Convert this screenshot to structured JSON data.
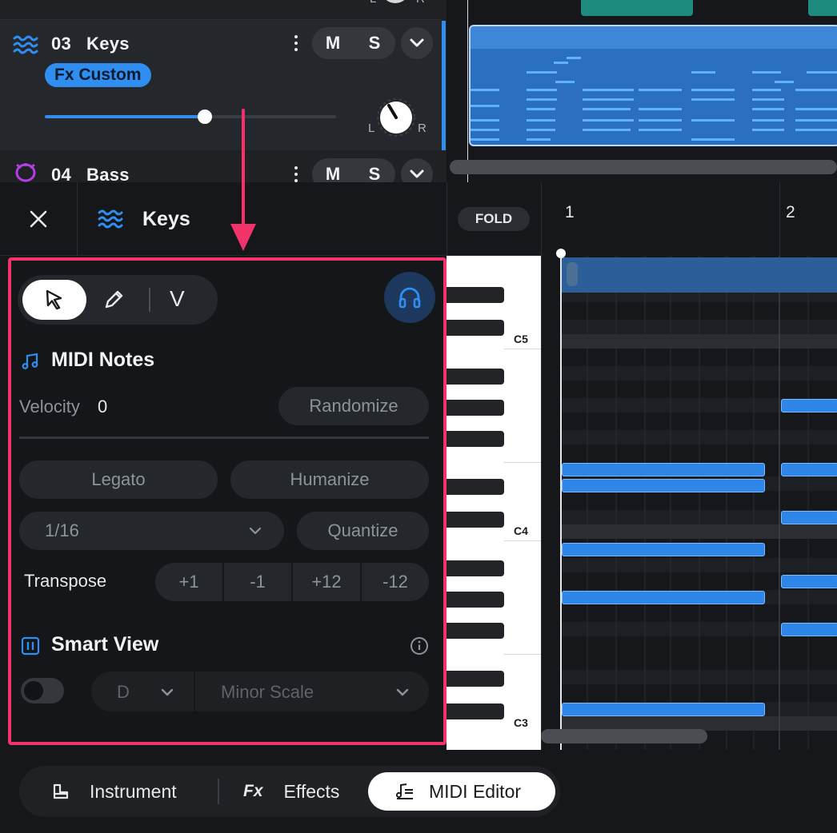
{
  "tracks": [
    {
      "number": "03",
      "name": "Keys",
      "fx_badge": "Fx Custom",
      "mute": "M",
      "solo": "S",
      "volume": 0.55,
      "pan_left": "L",
      "pan_right": "R",
      "color": "#2f8ef0"
    },
    {
      "number": "04",
      "name": "Bass",
      "mute": "M",
      "solo": "S",
      "color": "#b13ee6"
    }
  ],
  "top_pan_right": "R",
  "top_pan_left": "L",
  "editor": {
    "track_name": "Keys",
    "fold_label": "FOLD",
    "bar_numbers": [
      "1",
      "2"
    ]
  },
  "tools": {
    "select_icon": "cursor-arrow-icon",
    "pencil_icon": "pencil-icon",
    "velocity_tool_label": "V",
    "listen_icon": "headphones-icon"
  },
  "midi_notes": {
    "title": "MIDI Notes",
    "velocity_label": "Velocity",
    "velocity_value": "0",
    "randomize_label": "Randomize",
    "legato_label": "Legato",
    "humanize_label": "Humanize",
    "grid_value": "1/16",
    "quantize_label": "Quantize",
    "transpose_label": "Transpose",
    "transpose_buttons": [
      "+1",
      "-1",
      "+12",
      "-12"
    ]
  },
  "smart_view": {
    "title": "Smart View",
    "enabled": false,
    "key": "D",
    "scale": "Minor Scale"
  },
  "piano_labels": [
    "C5",
    "C4",
    "C3"
  ],
  "bottom_tabs": {
    "instrument": "Instrument",
    "effects_icon_text": "Fx",
    "effects": "Effects",
    "midi_editor": "MIDI Editor",
    "active": "midi_editor"
  },
  "colors": {
    "accent": "#2f8ef0",
    "highlight_border": "#f0346b",
    "clip_teal": "#1f8a80",
    "bass_purple": "#b13ee6"
  }
}
